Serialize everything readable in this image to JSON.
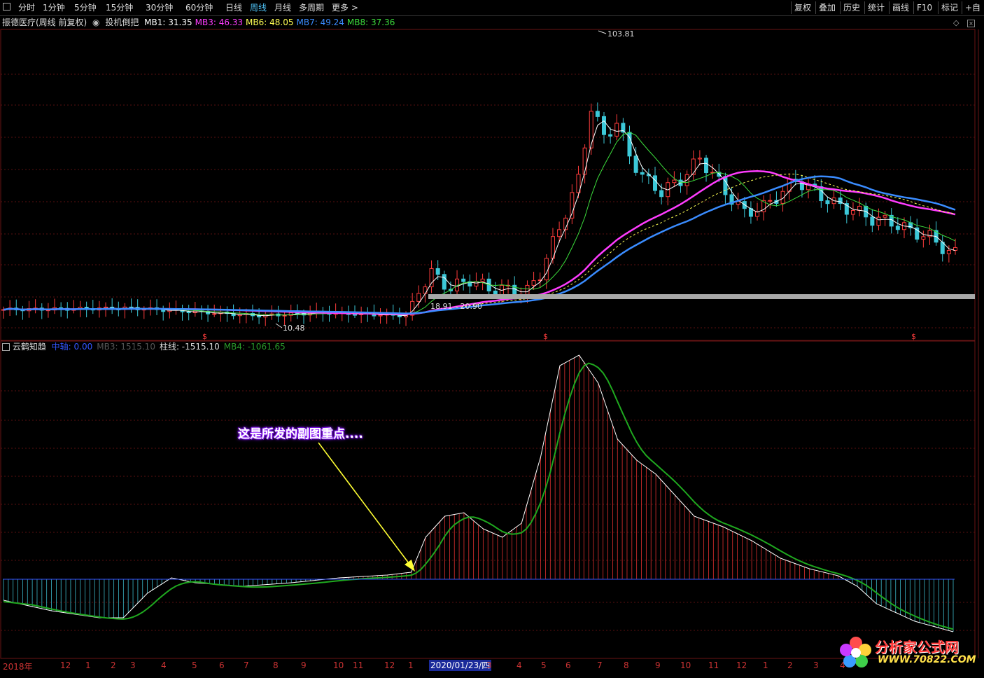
{
  "toolbar": {
    "periods": [
      "分时",
      "1分钟",
      "5分钟",
      "15分钟",
      "30分钟",
      "60分钟",
      "日线",
      "周线",
      "月线",
      "多周期",
      "更多"
    ],
    "active_period": "周线",
    "right_buttons": [
      "复权",
      "叠加",
      "历史",
      "统计",
      "画线",
      "F10",
      "标记",
      "+自"
    ]
  },
  "main_chart": {
    "stock_label": "振德医疗(周线 前复权)",
    "indicator_name": "投机倒把",
    "mb": [
      {
        "label": "MB1: 31.35",
        "color": "#ffffff"
      },
      {
        "label": "MB3: 46.33",
        "color": "#ff3cff"
      },
      {
        "label": "MB6: 48.05",
        "color": "#ffff54"
      },
      {
        "label": "MB7: 49.24",
        "color": "#3a8cff"
      },
      {
        "label": "MB8: 37.36",
        "color": "#3cdc3c"
      }
    ],
    "high_label": "103.81",
    "low_label": "10.48",
    "range_label": "18.91 - 20.90",
    "signal_marks": [
      "$",
      "$",
      "$"
    ]
  },
  "sub_chart": {
    "name": "云鹤知趋",
    "labels": [
      {
        "label": "中轴: 0.00",
        "color": "#3355ff"
      },
      {
        "label": "MB3: 1515.10",
        "color": "#555555"
      },
      {
        "label": "柱线: -1515.10",
        "color": "#dddddd"
      },
      {
        "label": "MB4: -1061.65",
        "color": "#2a9a2a"
      }
    ]
  },
  "annotation": {
    "text": "这是所发的副图重点...."
  },
  "date_axis": {
    "labels": [
      "2018年",
      "12",
      "1",
      "2",
      "3",
      "4",
      "5",
      "6",
      "7",
      "8",
      "9",
      "10",
      "11",
      "12",
      "1",
      "2",
      "3",
      "4",
      "5",
      "6",
      "7",
      "8",
      "9",
      "10",
      "11",
      "12",
      "1",
      "2",
      "3",
      "4"
    ],
    "highlight": "2020/01/23/四"
  },
  "watermark": {
    "title": "分析家公式网",
    "url": "WWW.70822.COM"
  }
}
